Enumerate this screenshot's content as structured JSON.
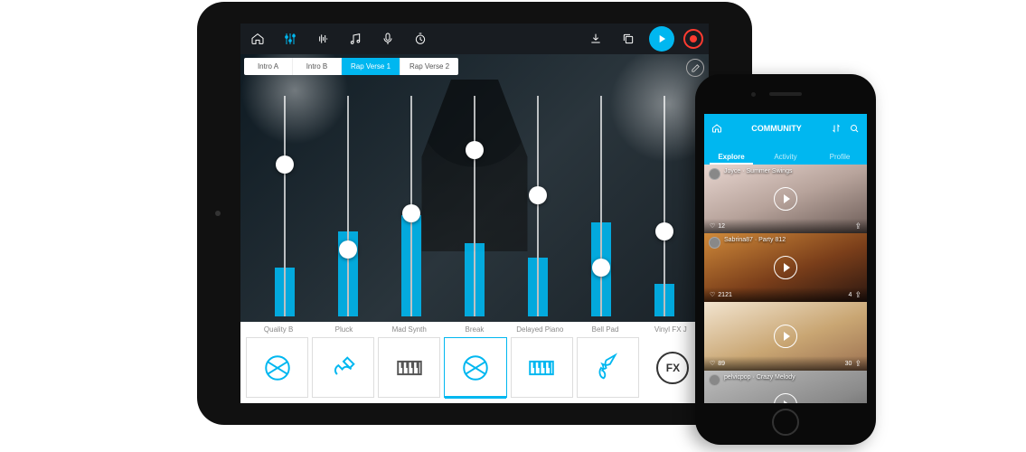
{
  "toolbar": {
    "icons": [
      "home",
      "sliders",
      "waveform",
      "music-note",
      "mic",
      "timer",
      "download",
      "duplicate"
    ]
  },
  "sections": [
    {
      "label": "Intro A",
      "active": false
    },
    {
      "label": "Intro B",
      "active": false
    },
    {
      "label": "Rap Verse 1",
      "active": true
    },
    {
      "label": "Rap Verse 2",
      "active": false
    }
  ],
  "colors": {
    "accent": "#00b7f0",
    "record": "#ff3b30"
  },
  "channels": [
    {
      "name": "Quality B",
      "knob": 0.72,
      "meter": 0.3,
      "icon": "drum",
      "active": false,
      "iconColor": "#00b7f0"
    },
    {
      "name": "Pluck",
      "knob": 0.25,
      "meter": 0.52,
      "icon": "guitar",
      "active": false,
      "iconColor": "#00b7f0"
    },
    {
      "name": "Mad Synth",
      "knob": 0.45,
      "meter": 0.62,
      "icon": "keys",
      "active": false,
      "iconColor": "#555"
    },
    {
      "name": "Break",
      "knob": 0.8,
      "meter": 0.45,
      "icon": "drum",
      "active": true,
      "iconColor": "#00b7f0"
    },
    {
      "name": "Delayed Piano",
      "knob": 0.55,
      "meter": 0.36,
      "icon": "keys",
      "active": false,
      "iconColor": "#00b7f0"
    },
    {
      "name": "Bell Pad",
      "knob": 0.15,
      "meter": 0.58,
      "icon": "violin",
      "active": false,
      "iconColor": "#00b7f0"
    },
    {
      "name": "Vinyl FX J",
      "knob": 0.35,
      "meter": 0.2,
      "icon": "fx",
      "active": false,
      "iconColor": "#333"
    }
  ],
  "phone": {
    "header": "COMMUNITY",
    "tabs": [
      {
        "label": "Explore",
        "active": true
      },
      {
        "label": "Activity",
        "active": false
      },
      {
        "label": "Profile",
        "active": false
      }
    ],
    "feed": [
      {
        "title": "Joyce · Summer Swings",
        "likes": 12,
        "comments": null
      },
      {
        "title": "Sabrina87 · Party 812",
        "likes": 2121,
        "comments": 4
      },
      {
        "title": "",
        "likes": 89,
        "comments": 30
      },
      {
        "title": "pelvicpop · Crazy Melody",
        "likes": null,
        "comments": null
      }
    ]
  }
}
